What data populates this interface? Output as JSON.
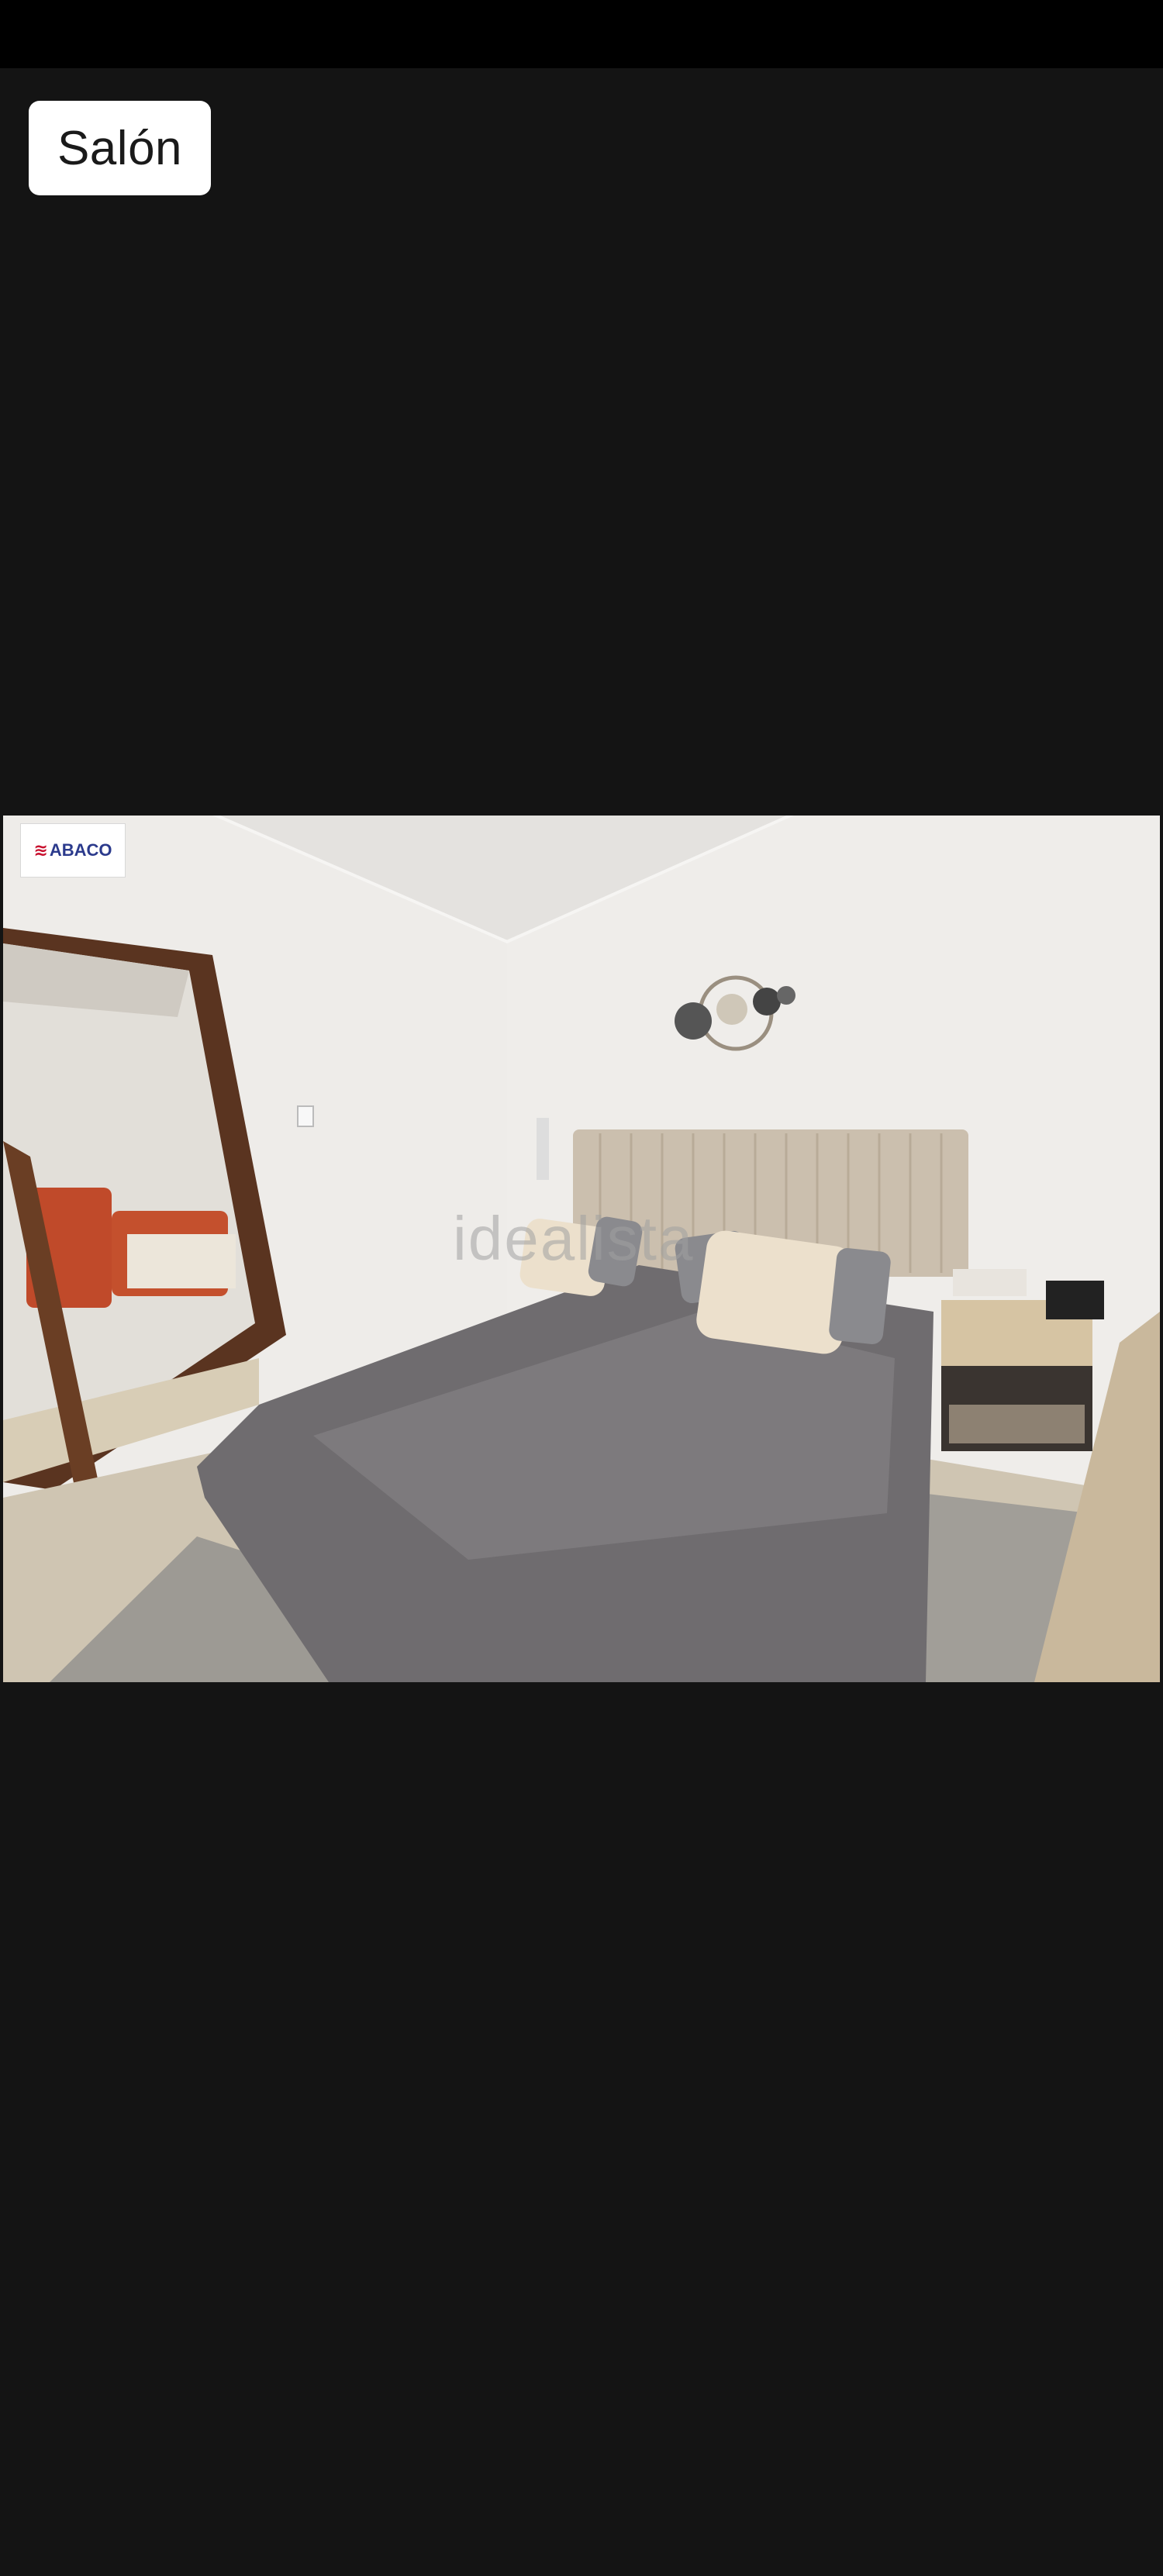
{
  "header": {
    "room_label": "Salón"
  },
  "photo": {
    "agency_logo_text": "ABACO",
    "watermark_text": "idealista"
  },
  "colors": {
    "background": "#141414",
    "chip_background": "#ffffff",
    "chip_text": "#1a1a1a"
  }
}
